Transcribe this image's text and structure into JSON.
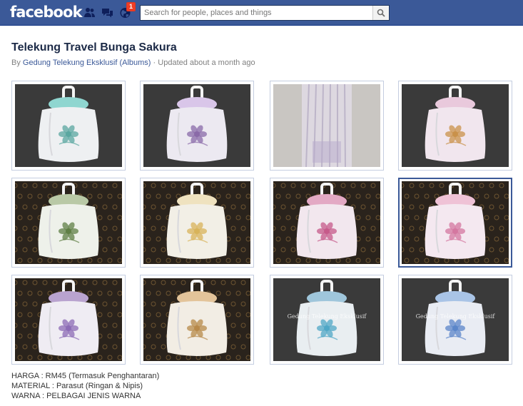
{
  "topbar": {
    "logo_text": "facebook",
    "notification_count": "1",
    "search_placeholder": "Search for people, places and things",
    "icons": [
      "friends-icon",
      "messages-icon",
      "notifications-icon",
      "search-icon"
    ]
  },
  "album": {
    "title": "Telekung Travel Bunga Sakura",
    "by_prefix": "By",
    "owner": "Gedung Telekung Eksklusif",
    "albums_link": "(Albums)",
    "updated": "· Updated about a month ago"
  },
  "photos": [
    {
      "style": "dark",
      "bag": "#eef0f2",
      "ribbon": "#8fd6d0",
      "flower": "#5aa7a0"
    },
    {
      "style": "dark",
      "bag": "#ece9f1",
      "ribbon": "#d9c6e9",
      "flower": "#8a6aa8"
    },
    {
      "style": "light",
      "bag": "#e7e3ee",
      "ribbon": "#e7e3ee",
      "flower": "#b9a7cf"
    },
    {
      "style": "dark",
      "bag": "#f1e6ee",
      "ribbon": "#e9c9dc",
      "flower": "#c9914a"
    },
    {
      "style": "batik",
      "bag": "#eef1ea",
      "ribbon": "#b9c9a6",
      "flower": "#5f7f45"
    },
    {
      "style": "batik",
      "bag": "#f2efe6",
      "ribbon": "#efe2bf",
      "flower": "#d8b35a"
    },
    {
      "style": "batik",
      "bag": "#f2e7ee",
      "ribbon": "#e3a9c4",
      "flower": "#c65a8a"
    },
    {
      "style": "batik",
      "bag": "#f4e8f0",
      "ribbon": "#efc2d6",
      "flower": "#d477a0"
    },
    {
      "style": "batik",
      "bag": "#efecf3",
      "ribbon": "#b9a3cf",
      "flower": "#8c6bb5"
    },
    {
      "style": "batik",
      "bag": "#f2ede4",
      "ribbon": "#e3c49a",
      "flower": "#b7894a"
    },
    {
      "style": "dark",
      "bag": "#e9eef1",
      "ribbon": "#9fc6db",
      "flower": "#4fa7c6"
    },
    {
      "style": "dark",
      "bag": "#e9ecf3",
      "ribbon": "#a9c4e6",
      "flower": "#5b86c9"
    }
  ],
  "watermarks": [
    "",
    "",
    "",
    "",
    "",
    "",
    "",
    "",
    "",
    "",
    "Gedung Telekung Eksklusif",
    "Gedung Telekung Eksklusif"
  ],
  "selected_photo": 7,
  "description": {
    "line1": "HARGA : RM45 (Termasuk Penghantaran)",
    "line2": "MATERIAL : Parasut (Ringan & Nipis)",
    "line3": "WARNA : PELBAGAI JENIS WARNA"
  }
}
